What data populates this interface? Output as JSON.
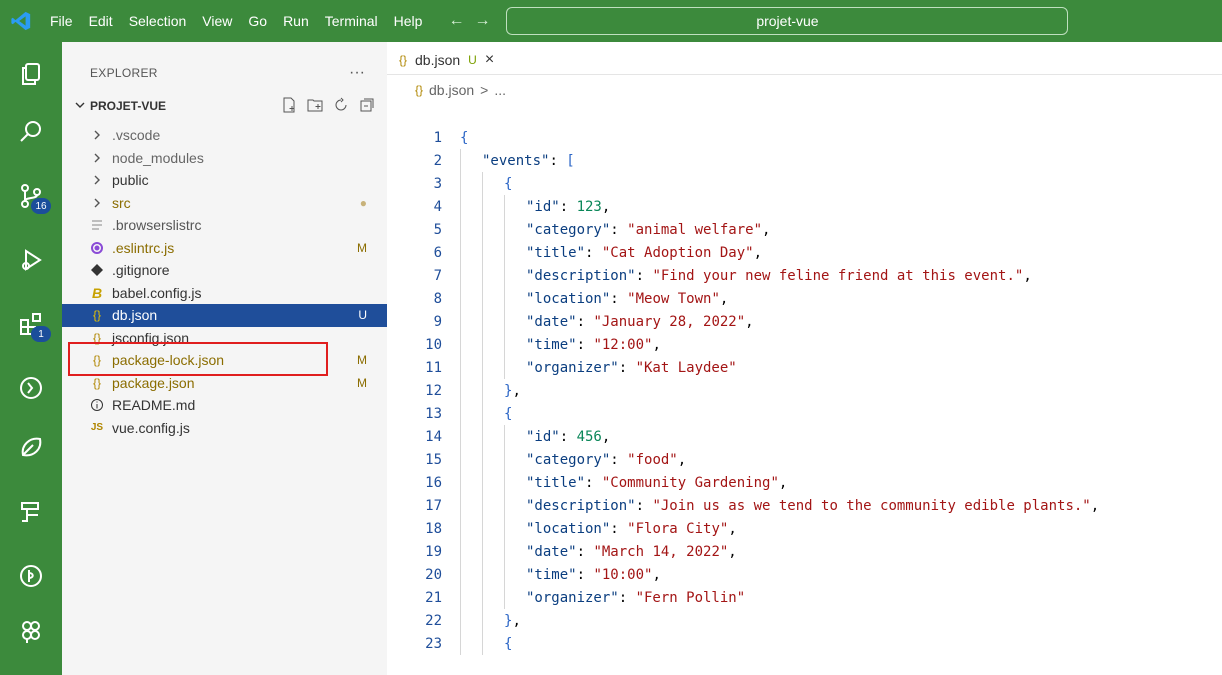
{
  "titlebar": {
    "menu": [
      "File",
      "Edit",
      "Selection",
      "View",
      "Go",
      "Run",
      "Terminal",
      "Help"
    ],
    "back_arrow": "←",
    "forward_arrow": "→",
    "search_text": "projet-vue"
  },
  "activitybar": {
    "icons": [
      "explorer-icon",
      "search-icon",
      "source-control-icon",
      "run-debug-icon",
      "extensions-icon",
      "remote-icon",
      "testing-icon",
      "docker-icon",
      "timeline-icon",
      "git-graph-icon"
    ],
    "source_control_badge": "16",
    "extensions_badge": "1"
  },
  "sidebar": {
    "title": "EXPLORER",
    "more": "···",
    "project": "PROJET-VUE",
    "items": [
      {
        "label": ".vscode",
        "icon": "chevron",
        "status": "",
        "color": "#666"
      },
      {
        "label": "node_modules",
        "icon": "chevron",
        "status": "",
        "color": "#666"
      },
      {
        "label": "public",
        "icon": "chevron",
        "status": "",
        "color": "#333"
      },
      {
        "label": "src",
        "icon": "chevron",
        "status": "●",
        "color": "#8b6d00"
      },
      {
        "label": ".browserslistrc",
        "icon": "lines",
        "status": "",
        "color": "#555"
      },
      {
        "label": ".eslintrc.js",
        "icon": "eslint",
        "status": "M",
        "color": "#8b6d00"
      },
      {
        "label": ".gitignore",
        "icon": "git",
        "status": "",
        "color": "#333"
      },
      {
        "label": "babel.config.js",
        "icon": "babel",
        "status": "",
        "color": "#333"
      },
      {
        "label": "db.json",
        "icon": "json",
        "status": "U",
        "color": "#fff"
      },
      {
        "label": "jsconfig.json",
        "icon": "json",
        "status": "",
        "color": "#333"
      },
      {
        "label": "package-lock.json",
        "icon": "json",
        "status": "M",
        "color": "#8b6d00"
      },
      {
        "label": "package.json",
        "icon": "json",
        "status": "M",
        "color": "#8b6d00"
      },
      {
        "label": "README.md",
        "icon": "info",
        "status": "",
        "color": "#333"
      },
      {
        "label": "vue.config.js",
        "icon": "js",
        "status": "",
        "color": "#333"
      }
    ]
  },
  "editor": {
    "tab": {
      "label": "db.json",
      "status": "U",
      "close": "×"
    },
    "breadcrumb": {
      "file": "db.json",
      "sep": ">",
      "more": "..."
    },
    "lines": [
      {
        "n": "1",
        "indent": 0,
        "parts": [
          [
            "{",
            "tok-brace"
          ]
        ]
      },
      {
        "n": "2",
        "indent": 1,
        "parts": [
          [
            "\"events\"",
            "tok-key"
          ],
          [
            ": ",
            "tok-punct"
          ],
          [
            "[",
            "tok-brace"
          ]
        ]
      },
      {
        "n": "3",
        "indent": 2,
        "parts": [
          [
            "{",
            "tok-brace"
          ]
        ]
      },
      {
        "n": "4",
        "indent": 3,
        "parts": [
          [
            "\"id\"",
            "tok-key"
          ],
          [
            ": ",
            "tok-punct"
          ],
          [
            "123",
            "tok-num"
          ],
          [
            ",",
            "tok-punct"
          ]
        ]
      },
      {
        "n": "5",
        "indent": 3,
        "parts": [
          [
            "\"category\"",
            "tok-key"
          ],
          [
            ": ",
            "tok-punct"
          ],
          [
            "\"animal welfare\"",
            "tok-str"
          ],
          [
            ",",
            "tok-punct"
          ]
        ]
      },
      {
        "n": "6",
        "indent": 3,
        "parts": [
          [
            "\"title\"",
            "tok-key"
          ],
          [
            ": ",
            "tok-punct"
          ],
          [
            "\"Cat Adoption Day\"",
            "tok-str"
          ],
          [
            ",",
            "tok-punct"
          ]
        ]
      },
      {
        "n": "7",
        "indent": 3,
        "parts": [
          [
            "\"description\"",
            "tok-key"
          ],
          [
            ": ",
            "tok-punct"
          ],
          [
            "\"Find your new feline friend at this event.\"",
            "tok-str"
          ],
          [
            ",",
            "tok-punct"
          ]
        ]
      },
      {
        "n": "8",
        "indent": 3,
        "parts": [
          [
            "\"location\"",
            "tok-key"
          ],
          [
            ": ",
            "tok-punct"
          ],
          [
            "\"Meow Town\"",
            "tok-str"
          ],
          [
            ",",
            "tok-punct"
          ]
        ]
      },
      {
        "n": "9",
        "indent": 3,
        "parts": [
          [
            "\"date\"",
            "tok-key"
          ],
          [
            ": ",
            "tok-punct"
          ],
          [
            "\"January 28, 2022\"",
            "tok-str"
          ],
          [
            ",",
            "tok-punct"
          ]
        ]
      },
      {
        "n": "10",
        "indent": 3,
        "parts": [
          [
            "\"time\"",
            "tok-key"
          ],
          [
            ": ",
            "tok-punct"
          ],
          [
            "\"12:00\"",
            "tok-str"
          ],
          [
            ",",
            "tok-punct"
          ]
        ]
      },
      {
        "n": "11",
        "indent": 3,
        "parts": [
          [
            "\"organizer\"",
            "tok-key"
          ],
          [
            ": ",
            "tok-punct"
          ],
          [
            "\"Kat Laydee\"",
            "tok-str"
          ]
        ]
      },
      {
        "n": "12",
        "indent": 2,
        "parts": [
          [
            "}",
            "tok-brace"
          ],
          [
            ",",
            "tok-punct"
          ]
        ]
      },
      {
        "n": "13",
        "indent": 2,
        "parts": [
          [
            "{",
            "tok-brace"
          ]
        ]
      },
      {
        "n": "14",
        "indent": 3,
        "parts": [
          [
            "\"id\"",
            "tok-key"
          ],
          [
            ": ",
            "tok-punct"
          ],
          [
            "456",
            "tok-num"
          ],
          [
            ",",
            "tok-punct"
          ]
        ]
      },
      {
        "n": "15",
        "indent": 3,
        "parts": [
          [
            "\"category\"",
            "tok-key"
          ],
          [
            ": ",
            "tok-punct"
          ],
          [
            "\"food\"",
            "tok-str"
          ],
          [
            ",",
            "tok-punct"
          ]
        ]
      },
      {
        "n": "16",
        "indent": 3,
        "parts": [
          [
            "\"title\"",
            "tok-key"
          ],
          [
            ": ",
            "tok-punct"
          ],
          [
            "\"Community Gardening\"",
            "tok-str"
          ],
          [
            ",",
            "tok-punct"
          ]
        ]
      },
      {
        "n": "17",
        "indent": 3,
        "parts": [
          [
            "\"description\"",
            "tok-key"
          ],
          [
            ": ",
            "tok-punct"
          ],
          [
            "\"Join us as we tend to the community edible plants.\"",
            "tok-str"
          ],
          [
            ",",
            "tok-punct"
          ]
        ]
      },
      {
        "n": "18",
        "indent": 3,
        "parts": [
          [
            "\"location\"",
            "tok-key"
          ],
          [
            ": ",
            "tok-punct"
          ],
          [
            "\"Flora City\"",
            "tok-str"
          ],
          [
            ",",
            "tok-punct"
          ]
        ]
      },
      {
        "n": "19",
        "indent": 3,
        "parts": [
          [
            "\"date\"",
            "tok-key"
          ],
          [
            ": ",
            "tok-punct"
          ],
          [
            "\"March 14, 2022\"",
            "tok-str"
          ],
          [
            ",",
            "tok-punct"
          ]
        ]
      },
      {
        "n": "20",
        "indent": 3,
        "parts": [
          [
            "\"time\"",
            "tok-key"
          ],
          [
            ": ",
            "tok-punct"
          ],
          [
            "\"10:00\"",
            "tok-str"
          ],
          [
            ",",
            "tok-punct"
          ]
        ]
      },
      {
        "n": "21",
        "indent": 3,
        "parts": [
          [
            "\"organizer\"",
            "tok-key"
          ],
          [
            ": ",
            "tok-punct"
          ],
          [
            "\"Fern Pollin\"",
            "tok-str"
          ]
        ]
      },
      {
        "n": "22",
        "indent": 2,
        "parts": [
          [
            "}",
            "tok-brace"
          ],
          [
            ",",
            "tok-punct"
          ]
        ]
      },
      {
        "n": "23",
        "indent": 2,
        "parts": [
          [
            "{",
            "tok-brace"
          ]
        ]
      }
    ]
  },
  "colors": {
    "accent": "#3c8a3c",
    "selected": "#1f4e9a",
    "highlight_box": "#e01e1e"
  }
}
